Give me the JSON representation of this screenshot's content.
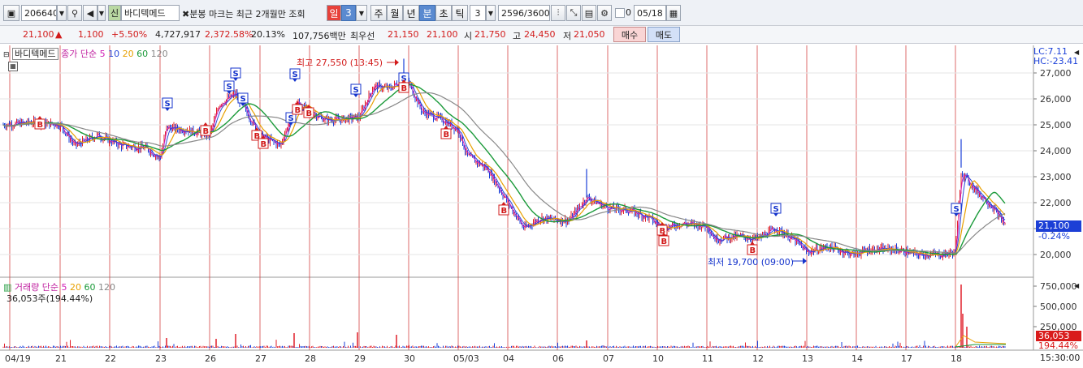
{
  "toolbar": {
    "code": "206640",
    "credit_badge": "신",
    "stock_name": "바디텍메드",
    "notice": "분봉 마크는 최근 2개월만 조회",
    "periods": [
      "일",
      "3",
      "주",
      "월",
      "년",
      "분",
      "초",
      "틱"
    ],
    "interval": "3",
    "count": "2596",
    "count_total": "/3600",
    "date": "05/18",
    "checkbox_label": "0"
  },
  "quote": {
    "price": "21,100",
    "arrow": "▲",
    "change": "1,100",
    "change_pct": "+5.50%",
    "volume": "4,727,917",
    "vol_ratio": "2,372.58%",
    "turnover": "20.13%",
    "amount": "107,756백만",
    "best_bid_label": "최우선",
    "best_ask": "21,150",
    "best_bid": "21,100",
    "open_label": "시",
    "open": "21,750",
    "high_label": "고",
    "high": "24,450",
    "low_label": "저",
    "low": "21,050",
    "buy_label": "매수",
    "sell_label": "매도"
  },
  "price_panel": {
    "title": "바디텍메드",
    "legend_label": "종가 단순",
    "ma_periods": [
      "5",
      "10",
      "20",
      "60",
      "120"
    ],
    "lc": "LC:7.11",
    "hc": "HC:-23.41",
    "high_note": "최고 27,550 (13:45)",
    "low_note": "최저 19,700 (09:00)",
    "current_price": "21,100",
    "current_pct": "-0.24%",
    "y_ticks": [
      "27,000",
      "26,000",
      "25,000",
      "24,000",
      "23,000",
      "22,000",
      "21,000",
      "20,000"
    ]
  },
  "volume_panel": {
    "legend_label": "거래량 단순",
    "ma_periods": [
      "5",
      "20",
      "60",
      "120"
    ],
    "value_note": "36,053주(194.44%)",
    "y_ticks": [
      "750,000",
      "500,000",
      "250,000"
    ],
    "current_value": "36,053",
    "current_pct": "194.44%"
  },
  "x_axis": {
    "labels": [
      "04/19",
      "21",
      "22",
      "23",
      "26",
      "27",
      "28",
      "29",
      "30",
      "05/03",
      "04",
      "06",
      "07",
      "10",
      "11",
      "12",
      "13",
      "14",
      "17",
      "18"
    ],
    "time": "15:30:00"
  },
  "markers": {
    "sell": "S",
    "buy": "B"
  },
  "colors": {
    "ma5": "#d01fb6",
    "ma10": "#2a47d8",
    "ma20": "#e8a000",
    "ma60": "#1b9a3a",
    "ma120": "#888888",
    "up": "#e0202a",
    "down": "#1a3fd8",
    "separator": "#d23a3a"
  }
}
